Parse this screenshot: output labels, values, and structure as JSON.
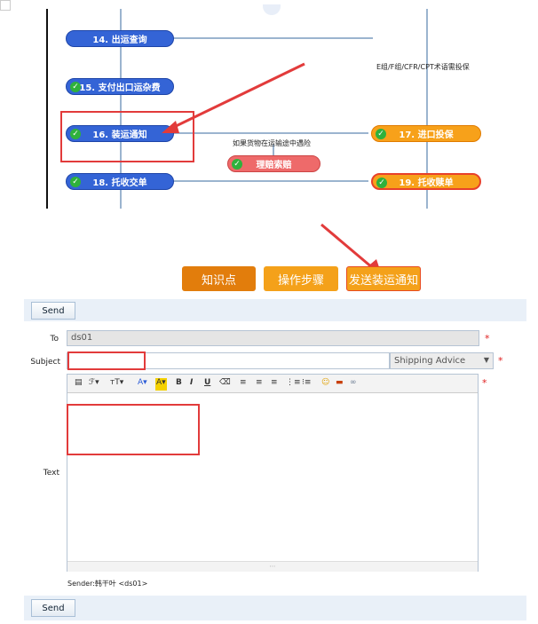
{
  "flow": {
    "node14": "14. 出运查询",
    "node15": "15. 支付出口运杂费",
    "node16": "16. 装运通知",
    "node17": "17. 进口投保",
    "node18": "18. 托收交单",
    "node19": "19. 托收赎单",
    "node_claim": "理赔索赔",
    "note_terms": "E组/F组/CFR/CPT术语需投保",
    "note_risk": "如果货物在运输途中遇险"
  },
  "actions": {
    "knowledge": "知识点",
    "steps": "操作步骤",
    "send_notice": "发送装运通知"
  },
  "form": {
    "send_label": "Send",
    "to_label": "To",
    "to_value": "ds01",
    "subject_label": "Subject",
    "subject_value": "",
    "subject_select": "Shipping Advice",
    "text_label": "Text",
    "sender": "Sender:韩干叶 <ds01>",
    "required": "*"
  },
  "colors": {
    "blue_node": "#3464d6",
    "orange_node": "#f7a11a",
    "orange_button": "#e27d0c",
    "highlight": "#e23b3b"
  }
}
